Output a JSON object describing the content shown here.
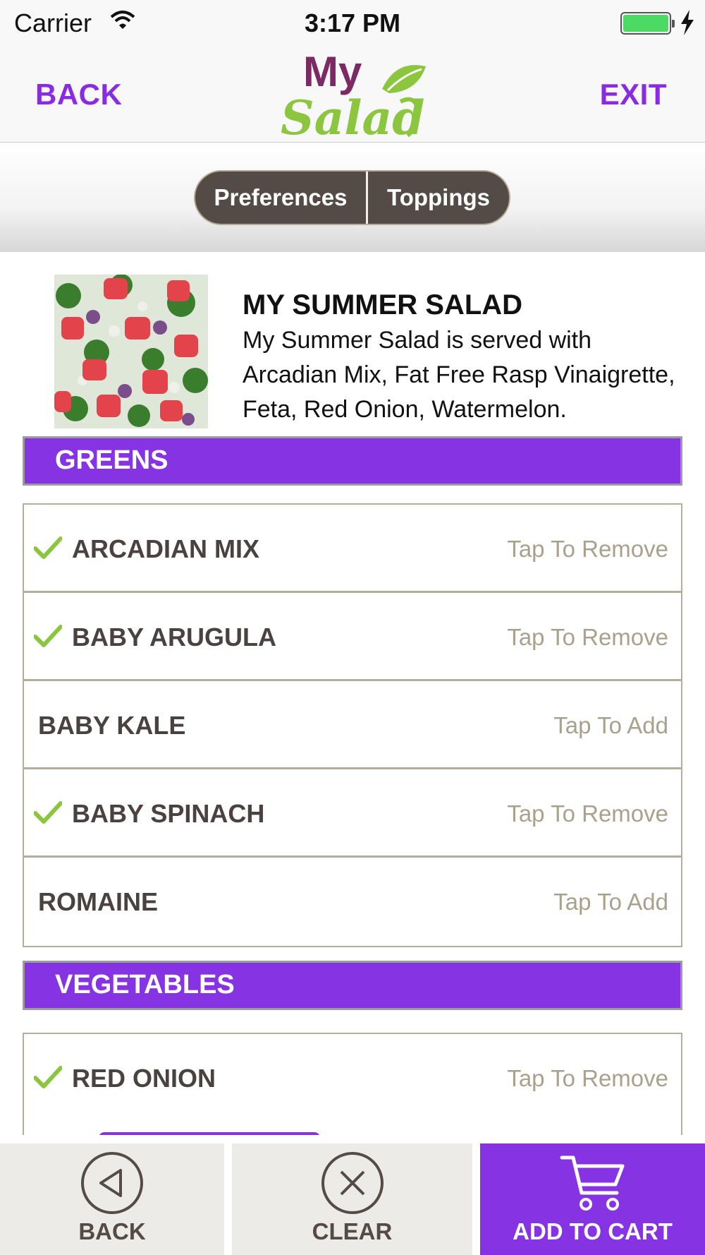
{
  "status_bar": {
    "carrier": "Carrier",
    "time": "3:17 PM"
  },
  "nav": {
    "back_label": "BACK",
    "exit_label": "EXIT",
    "logo_line1": "My",
    "logo_line2": "Salad"
  },
  "segmented": {
    "items": [
      "Preferences",
      "Toppings"
    ]
  },
  "salad": {
    "title": "MY SUMMER SALAD",
    "description": "My Summer Salad is served with Arcadian Mix, Fat Free Rasp Vinaigrette, Feta, Red Onion, Watermelon."
  },
  "sections": [
    {
      "title": "GREENS",
      "items": [
        {
          "name": "ARCADIAN MIX",
          "action": "Tap To Remove",
          "selected": true
        },
        {
          "name": "BABY ARUGULA",
          "action": "Tap To Remove",
          "selected": true
        },
        {
          "name": "BABY KALE",
          "action": "Tap To Add",
          "selected": false
        },
        {
          "name": "BABY SPINACH",
          "action": "Tap To Remove",
          "selected": true
        },
        {
          "name": "ROMAINE",
          "action": "Tap To Add",
          "selected": false
        }
      ]
    },
    {
      "title": "VEGETABLES",
      "items": [
        {
          "name": "RED ONION",
          "action": "Tap To Remove",
          "selected": true
        }
      ]
    }
  ],
  "bottom_bar": {
    "back_label": "BACK",
    "clear_label": "CLEAR",
    "cart_label": "ADD TO CART"
  },
  "colors": {
    "accent_purple": "#8633e3",
    "logo_purple": "#7b2a63",
    "logo_green": "#8cc63f",
    "check_green": "#8cc63f",
    "segment_dark": "#544b47"
  },
  "icons": [
    "wifi-icon",
    "battery-icon",
    "charging-icon",
    "check-icon",
    "back-arrow-icon",
    "clear-x-icon",
    "cart-icon"
  ]
}
